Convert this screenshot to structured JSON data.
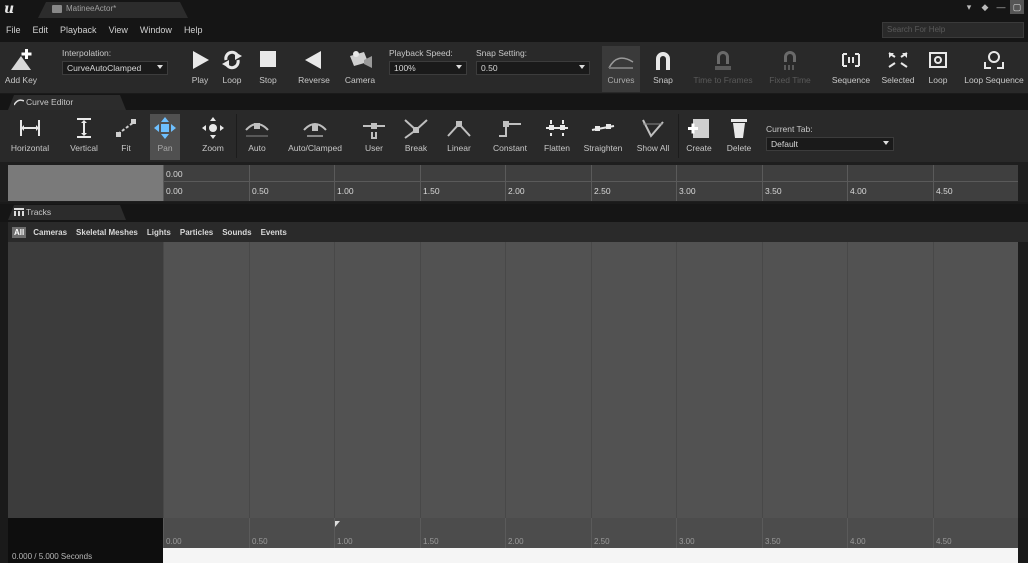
{
  "window": {
    "tab_title": "MatineeActor*",
    "logo": "u",
    "controls": [
      "▾",
      "◆",
      "—",
      "▢"
    ]
  },
  "menu": [
    "File",
    "Edit",
    "Playback",
    "View",
    "Window",
    "Help"
  ],
  "search": {
    "placeholder": "Search For Help"
  },
  "toolbar": {
    "add_key": "Add Key",
    "interpolation_label": "Interpolation:",
    "interpolation_value": "CurveAutoClamped",
    "play": "Play",
    "loop": "Loop",
    "stop": "Stop",
    "reverse": "Reverse",
    "camera": "Camera",
    "playback_speed_label": "Playback Speed:",
    "playback_speed_value": "100%",
    "snap_setting_label": "Snap Setting:",
    "snap_setting_value": "0.50",
    "curves": "Curves",
    "snap": "Snap",
    "time_to_frames": "Time to Frames",
    "fixed_time": "Fixed Time",
    "sequence": "Sequence",
    "selected": "Selected",
    "loop2": "Loop",
    "loop_sequence": "Loop Sequence"
  },
  "curve_editor": {
    "tab": "Curve Editor",
    "tools": {
      "horizontal": "Horizontal",
      "vertical": "Vertical",
      "fit": "Fit",
      "pan": "Pan",
      "zoom": "Zoom",
      "auto": "Auto",
      "auto_clamped": "Auto/Clamped",
      "user": "User",
      "break": "Break",
      "linear": "Linear",
      "constant": "Constant",
      "flatten": "Flatten",
      "straighten": "Straighten",
      "show_all": "Show All",
      "create": "Create",
      "delete": "Delete"
    },
    "current_tab_label": "Current Tab:",
    "current_tab_value": "Default",
    "ruler_top": "0.00",
    "ruler_ticks": [
      "0.00",
      "0.50",
      "1.00",
      "1.50",
      "2.00",
      "2.50",
      "3.00",
      "3.50",
      "4.00",
      "4.50"
    ]
  },
  "tracks": {
    "tab": "Tracks",
    "filters": [
      "All",
      "Cameras",
      "Skeletal Meshes",
      "Lights",
      "Particles",
      "Sounds",
      "Events"
    ],
    "active_filter": "All",
    "timeline_ticks": [
      "0.00",
      "0.50",
      "1.00",
      "1.50",
      "2.00",
      "2.50",
      "3.00",
      "3.50",
      "4.00",
      "4.50"
    ],
    "status": "0.000 / 5.000 Seconds"
  },
  "colors": {
    "background": "#1a1a1a",
    "toolbar": "#292929",
    "track_area": "#525252",
    "active_filter": "#6e6e6e"
  }
}
